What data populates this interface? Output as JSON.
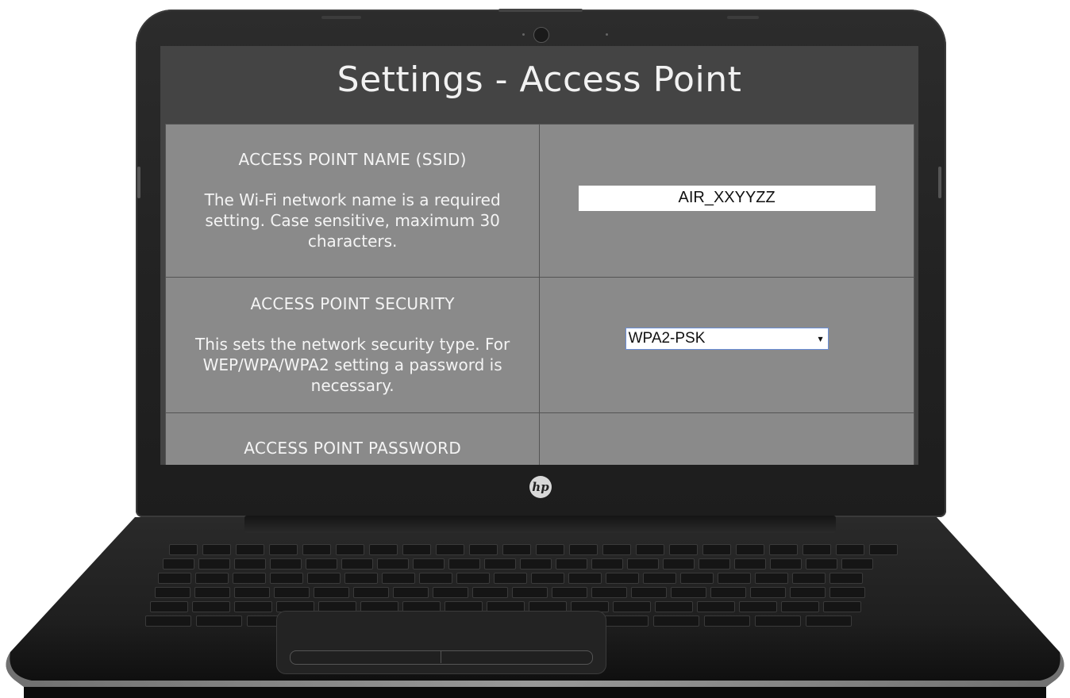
{
  "page": {
    "title": "Settings - Access Point"
  },
  "settings": [
    {
      "label": "ACCESS POINT NAME (SSID)",
      "description": "The Wi-Fi network name is a required setting. Case sensitive, maximum 30 characters.",
      "value": "AIR_XXYYZZ"
    },
    {
      "label": "ACCESS POINT SECURITY",
      "description": "This sets the network security type. For WEP/WPA/WPA2 setting a password is necessary.",
      "value": "WPA2-PSK"
    },
    {
      "label": "ACCESS POINT PASSWORD"
    }
  ],
  "device": {
    "logo_text": "hp"
  },
  "colors": {
    "screen_background": "#444444",
    "table_background": "#8a8a8a",
    "text": "#f4f4f4"
  }
}
